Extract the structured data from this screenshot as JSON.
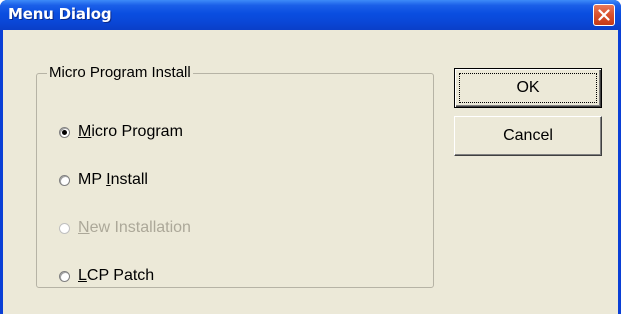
{
  "window": {
    "title": "Menu Dialog",
    "close_icon": "close-icon",
    "title_color": "#0a48d8",
    "close_color": "#d9502c",
    "client_bg": "#ece9d8"
  },
  "group": {
    "label": "Micro Program Install",
    "options": [
      {
        "pre": "",
        "mnemonic": "M",
        "post": "icro Program",
        "checked": true,
        "enabled": true
      },
      {
        "pre": "MP ",
        "mnemonic": "I",
        "post": "nstall",
        "checked": false,
        "enabled": true
      },
      {
        "pre": "",
        "mnemonic": "N",
        "post": "ew Installation",
        "checked": false,
        "enabled": false
      },
      {
        "pre": "",
        "mnemonic": "L",
        "post": "CP Patch",
        "checked": false,
        "enabled": true
      }
    ]
  },
  "buttons": {
    "ok_label": "OK",
    "cancel_label": "Cancel"
  }
}
